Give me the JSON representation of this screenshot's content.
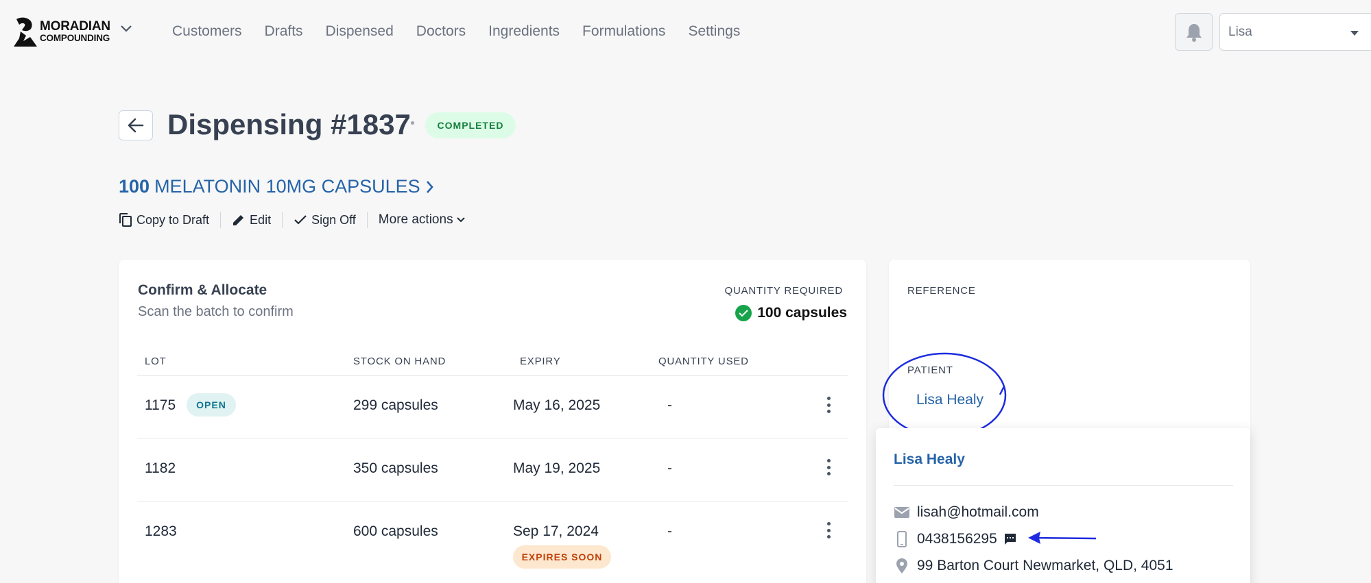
{
  "app": {
    "logo_line1": "MORADIAN",
    "logo_line2": "COMPOUNDING"
  },
  "nav": {
    "items": [
      "Customers",
      "Drafts",
      "Dispensed",
      "Doctors",
      "Ingredients",
      "Formulations",
      "Settings"
    ]
  },
  "user_select": {
    "value": "Lisa"
  },
  "header": {
    "title": "Dispensing #1837",
    "status": "COMPLETED",
    "product_qty": "100",
    "product_name": "MELATONIN 10MG CAPSULES"
  },
  "actions": {
    "copy": "Copy to Draft",
    "edit": "Edit",
    "sign_off": "Sign Off",
    "more": "More actions"
  },
  "allocate": {
    "title": "Confirm & Allocate",
    "subtitle": "Scan the batch to confirm",
    "quantity_label": "QUANTITY REQUIRED",
    "quantity_value": "100 capsules",
    "columns": [
      "LOT",
      "STOCK ON HAND",
      "EXPIRY",
      "QUANTITY USED"
    ],
    "rows": [
      {
        "lot": "1175",
        "badge": "OPEN",
        "stock": "299 capsules",
        "expiry": "May 16, 2025",
        "used": "-"
      },
      {
        "lot": "1182",
        "badge": "",
        "stock": "350 capsules",
        "expiry": "May 19, 2025",
        "used": "-"
      },
      {
        "lot": "1283",
        "badge": "EXPIRES SOON",
        "stock": "600 capsules",
        "expiry": "Sep 17, 2024",
        "used": "-"
      }
    ]
  },
  "reference": {
    "label": "REFERENCE",
    "patient_label": "PATIENT",
    "patient_name": "Lisa Healy"
  },
  "popover": {
    "name": "Lisa Healy",
    "email": "lisah@hotmail.com",
    "phone": "0438156295",
    "address": "99 Barton Court Newmarket, QLD, 4051"
  },
  "colors": {
    "accent": "#2563a8",
    "success": "#16a34a",
    "annotation": "#1d2be0",
    "warning": "#c2410c"
  }
}
